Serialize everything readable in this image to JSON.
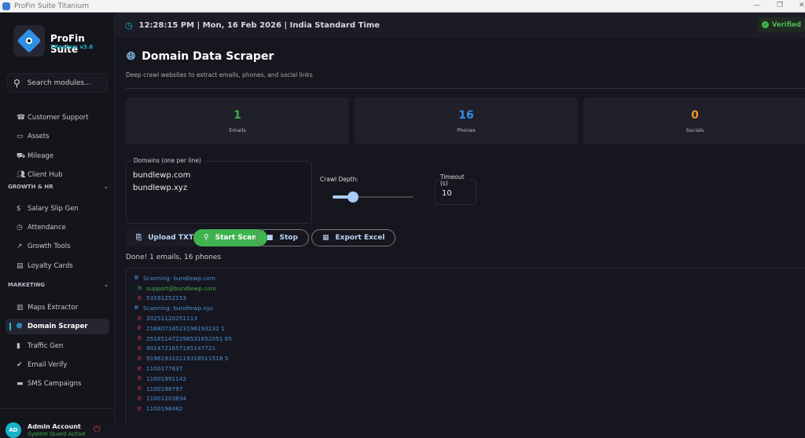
{
  "window": {
    "title": "ProFin Suite Titanium"
  },
  "sidebar": {
    "brand": "ProFin Suite",
    "version": "Titanium v3.6",
    "search_placeholder": "Search modules...",
    "items_top": [
      {
        "label": "Customer Support",
        "icon": "headset-icon"
      },
      {
        "label": "Assets",
        "icon": "laptop-icon"
      },
      {
        "label": "Mileage",
        "icon": "car-icon"
      },
      {
        "label": "Client Hub",
        "icon": "users-icon"
      }
    ],
    "sections": [
      {
        "title": "GROWTH & HR",
        "items": [
          {
            "label": "Salary Slip Gen",
            "icon": "dollar-icon"
          },
          {
            "label": "Attendance",
            "icon": "clock-icon"
          },
          {
            "label": "Growth Tools",
            "icon": "trending-icon"
          },
          {
            "label": "Loyalty Cards",
            "icon": "card-icon"
          }
        ]
      },
      {
        "title": "MARKETING",
        "items": [
          {
            "label": "Maps Extractor",
            "icon": "map-icon"
          },
          {
            "label": "Domain Scraper",
            "icon": "globe-icon",
            "active": true
          },
          {
            "label": "Traffic Gen",
            "icon": "traffic-icon"
          },
          {
            "label": "Email Verify",
            "icon": "check-badge-icon"
          },
          {
            "label": "SMS Campaigns",
            "icon": "message-icon"
          }
        ]
      }
    ],
    "user": {
      "initials": "AD",
      "name": "Admin Account",
      "status": "System Guard Active"
    }
  },
  "header": {
    "datetime": "12:28:15 PM | Mon, 16 Feb 2026 | India Standard Time",
    "verified": "Verified"
  },
  "page": {
    "title": "Domain Data Scraper",
    "subtitle": "Deep crawl websites to extract emails, phones, and social links",
    "stats": [
      {
        "value": "1",
        "label": "Emails",
        "color": "#3fae4a"
      },
      {
        "value": "16",
        "label": "Phones",
        "color": "#2f8fe6"
      },
      {
        "value": "0",
        "label": "Socials",
        "color": "#e89a2c"
      }
    ],
    "domains_label": "Domains (one per line)",
    "domains_value": "bundlewp.com\nbundlewp.xyz",
    "crawl_label": "Crawl Depth:",
    "crawl_depth": {
      "min": 1,
      "max": 5,
      "value": 2
    },
    "timeout_label": "Timeout (s)",
    "timeout_value": "10",
    "buttons": {
      "upload": "Upload TXT",
      "start": "Start Scan",
      "stop": "Stop",
      "export": "Export Excel"
    },
    "status": "Done! 1 emails, 16 phones",
    "log": [
      {
        "type": "scan",
        "text": "Scanning: bundlewp.com"
      },
      {
        "type": "email",
        "text": "support@bundlewp.com"
      },
      {
        "type": "phone",
        "text": "53191252153"
      },
      {
        "type": "scan",
        "text": "Scanning: bundlewp.xyz"
      },
      {
        "type": "phone",
        "text": "20251120251113"
      },
      {
        "type": "phone",
        "text": "21880718523196193232 1"
      },
      {
        "type": "phone",
        "text": "251851472298531652051 65"
      },
      {
        "type": "phone",
        "text": "9014721657185147721"
      },
      {
        "type": "phone",
        "text": "919619310119318511518 5"
      },
      {
        "type": "phone",
        "text": "1100177637"
      },
      {
        "type": "phone",
        "text": "11001991142"
      },
      {
        "type": "phone",
        "text": "1100198797"
      },
      {
        "type": "phone",
        "text": "11001203834"
      },
      {
        "type": "phone",
        "text": "1100198482"
      }
    ]
  }
}
